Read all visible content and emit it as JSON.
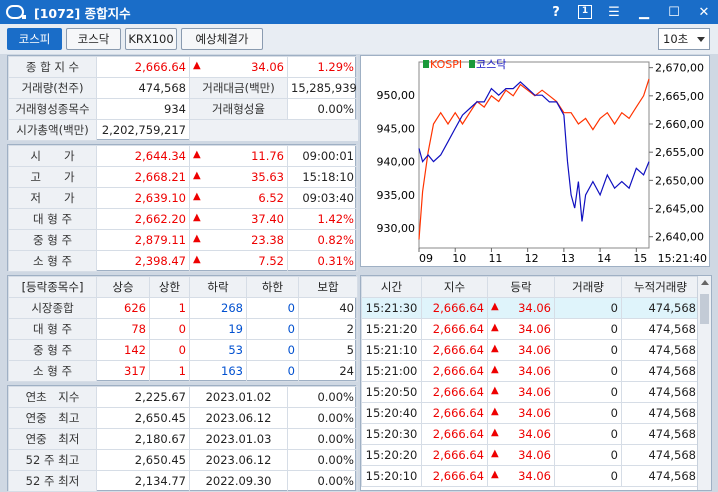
{
  "window": {
    "title": "[1072] 종합지수",
    "help": "?",
    "page": "1"
  },
  "tabs": [
    "코스피",
    "코스닥",
    "KRX100",
    "예상체결가"
  ],
  "interval": "10초",
  "summary": [
    {
      "l1": "종 합 지 수",
      "v1": "2,666.64",
      "a": "▲",
      "v2": "34.06",
      "v3": "1.29%"
    },
    {
      "l1": "거래량(천주)",
      "v1": "474,568",
      "l2": "거래대금(백만)",
      "v2": "15,285,939"
    },
    {
      "l1": "거래형성종목수",
      "v1": "934",
      "l2": "거래형성율",
      "v2": "0.00%"
    },
    {
      "l1": "시가총액(백만)",
      "v1": "2,202,759,217"
    }
  ],
  "prices": [
    {
      "l": "시　　가",
      "v": "2,644.34",
      "c": "11.76",
      "t": "09:00:01"
    },
    {
      "l": "고　　가",
      "v": "2,668.21",
      "c": "35.63",
      "t": "15:18:10"
    },
    {
      "l": "저　　가",
      "v": "2,639.10",
      "c": "6.52",
      "t": "09:03:40"
    },
    {
      "l": "대 형 주",
      "v": "2,662.20",
      "c": "37.40",
      "t": "1.42%"
    },
    {
      "l": "중 형 주",
      "v": "2,879.11",
      "c": "23.38",
      "t": "0.82%"
    },
    {
      "l": "소 형 주",
      "v": "2,398.47",
      "c": "7.52",
      "t": "0.31%"
    }
  ],
  "breadth": {
    "headers": [
      "[등락종목수]",
      "상승",
      "상한",
      "하락",
      "하한",
      "보합"
    ],
    "rows": [
      {
        "l": "시장종합",
        "up": "626",
        "uplim": "1",
        "dn": "268",
        "dnlim": "0",
        "flat": "40"
      },
      {
        "l": "대 형 주",
        "up": "78",
        "uplim": "0",
        "dn": "19",
        "dnlim": "0",
        "flat": "2"
      },
      {
        "l": "중 형 주",
        "up": "142",
        "uplim": "0",
        "dn": "53",
        "dnlim": "0",
        "flat": "5"
      },
      {
        "l": "소 형 주",
        "up": "317",
        "uplim": "1",
        "dn": "163",
        "dnlim": "0",
        "flat": "24"
      }
    ]
  },
  "yearly": [
    {
      "l": "연초　지수",
      "v": "2,225.67",
      "d": "2023.01.02",
      "p": "0.00%"
    },
    {
      "l": "연중　최고",
      "v": "2,650.45",
      "d": "2023.06.12",
      "p": "0.00%"
    },
    {
      "l": "연중　최저",
      "v": "2,180.67",
      "d": "2023.01.03",
      "p": "0.00%"
    },
    {
      "l": "52 주 최고",
      "v": "2,650.45",
      "d": "2023.06.12",
      "p": "0.00%"
    },
    {
      "l": "52 주 최저",
      "v": "2,134.77",
      "d": "2022.09.30",
      "p": "0.00%"
    }
  ],
  "ticks": {
    "headers": [
      "시간",
      "지수",
      "등락",
      "거래량",
      "누적거래량"
    ],
    "rows": [
      {
        "t": "15:21:30",
        "i": "2,666.64",
        "c": "34.06",
        "v": "0",
        "cum": "474,568"
      },
      {
        "t": "15:21:20",
        "i": "2,666.64",
        "c": "34.06",
        "v": "0",
        "cum": "474,568"
      },
      {
        "t": "15:21:10",
        "i": "2,666.64",
        "c": "34.06",
        "v": "0",
        "cum": "474,568"
      },
      {
        "t": "15:21:00",
        "i": "2,666.64",
        "c": "34.06",
        "v": "0",
        "cum": "474,568"
      },
      {
        "t": "15:20:50",
        "i": "2,666.64",
        "c": "34.06",
        "v": "0",
        "cum": "474,568"
      },
      {
        "t": "15:20:40",
        "i": "2,666.64",
        "c": "34.06",
        "v": "0",
        "cum": "474,568"
      },
      {
        "t": "15:20:30",
        "i": "2,666.64",
        "c": "34.06",
        "v": "0",
        "cum": "474,568"
      },
      {
        "t": "15:20:20",
        "i": "2,666.64",
        "c": "34.06",
        "v": "0",
        "cum": "474,568"
      },
      {
        "t": "15:20:10",
        "i": "2,666.64",
        "c": "34.06",
        "v": "0",
        "cum": "474,568"
      }
    ]
  },
  "chart_data": {
    "type": "line",
    "legend": [
      "KOSPI",
      "코스닥"
    ],
    "x_ticks": [
      "09",
      "10",
      "11",
      "12",
      "13",
      "14",
      "15",
      "15:21:40"
    ],
    "y_left_ticks": [
      "950,00",
      "945,00",
      "940,00",
      "935,00",
      "930,00"
    ],
    "y_right_ticks": [
      "2,670,00",
      "2,665,00",
      "2,660,00",
      "2,655,00",
      "2,650,00",
      "2,645,00",
      "2,640,00"
    ],
    "ylim_left": [
      927,
      955
    ],
    "ylim_right": [
      2638,
      2671
    ],
    "series": [
      {
        "name": "KOSPI",
        "color": "#ff3300",
        "axis": "right",
        "x": [
          9.0,
          9.1,
          9.25,
          9.4,
          9.6,
          9.8,
          10.0,
          10.2,
          10.4,
          10.6,
          10.8,
          11.0,
          11.2,
          11.4,
          11.6,
          11.8,
          12.0,
          12.2,
          12.4,
          12.6,
          12.8,
          13.0,
          13.2,
          13.4,
          13.6,
          13.8,
          14.0,
          14.2,
          14.4,
          14.6,
          14.8,
          15.0,
          15.2,
          15.35
        ],
        "values": [
          2639.5,
          2648,
          2655,
          2660,
          2662,
          2660,
          2662,
          2660,
          2662,
          2664,
          2663,
          2665,
          2664,
          2666,
          2665,
          2667,
          2666,
          2665,
          2666,
          2665,
          2664,
          2662,
          2662,
          2660,
          2661,
          2659,
          2661,
          2662,
          2660,
          2662,
          2661,
          2663,
          2665,
          2668
        ]
      },
      {
        "name": "코스닥",
        "color": "#1010c0",
        "axis": "left",
        "x": [
          9.0,
          9.1,
          9.25,
          9.4,
          9.6,
          9.8,
          10.0,
          10.2,
          10.4,
          10.6,
          10.8,
          11.0,
          11.2,
          11.4,
          11.6,
          11.8,
          12.0,
          12.2,
          12.4,
          12.6,
          12.8,
          13.0,
          13.1,
          13.2,
          13.3,
          13.4,
          13.5,
          13.6,
          13.8,
          14.0,
          14.2,
          14.4,
          14.6,
          14.8,
          15.0,
          15.2,
          15.35
        ],
        "values": [
          942,
          940,
          941,
          940,
          941,
          943,
          945,
          947,
          948,
          949,
          949,
          951,
          950,
          951,
          951,
          952,
          951,
          950,
          950,
          949,
          949,
          947,
          940,
          935,
          933,
          937,
          931,
          935,
          937,
          935,
          938,
          936,
          937,
          936,
          939,
          938,
          940
        ]
      }
    ]
  }
}
